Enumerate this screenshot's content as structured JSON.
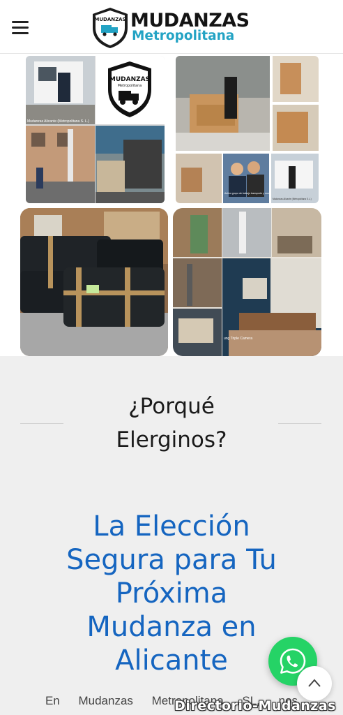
{
  "header": {
    "logo_line1": "MUDANZAS",
    "logo_line2": "Metropolitana",
    "shield_text": "MUDANZAS",
    "shield_subtext": "METROPOLITANA",
    "menu_icon": "hamburger-menu-icon"
  },
  "gallery": {
    "caption_tl": "Mudanzas Alicante (Metropolitana S. L.)",
    "badge_text": "MUDANZAS",
    "badge_subtext": "Metropolitana",
    "caption_tr1": "Activo grupo de trabajo transporte y mudanzas metropolitana españa",
    "caption_tr2": "Mudanzas Alicante (Metropolitana S.L.)",
    "caption_br": "ung Triple Camera"
  },
  "section": {
    "why_title_line1": "¿Porqué",
    "why_title_line2": "Elerginos?",
    "heading_line1": "La Elección",
    "heading_line2": "Segura para Tu",
    "heading_line3": "Próxima",
    "heading_line4": "Mudanza en",
    "heading_line5": "Alicante",
    "body_text": "En Mudanzas Metropolitana SL, nos"
  },
  "floating": {
    "whatsapp_icon": "whatsapp-icon",
    "scroll_top_icon": "chevron-up-icon"
  },
  "watermark": "Directorio-Mudanzas",
  "colors": {
    "brand_blue": "#1565c0",
    "logo_teal": "#23a3c4",
    "whatsapp_green": "#25d366"
  }
}
